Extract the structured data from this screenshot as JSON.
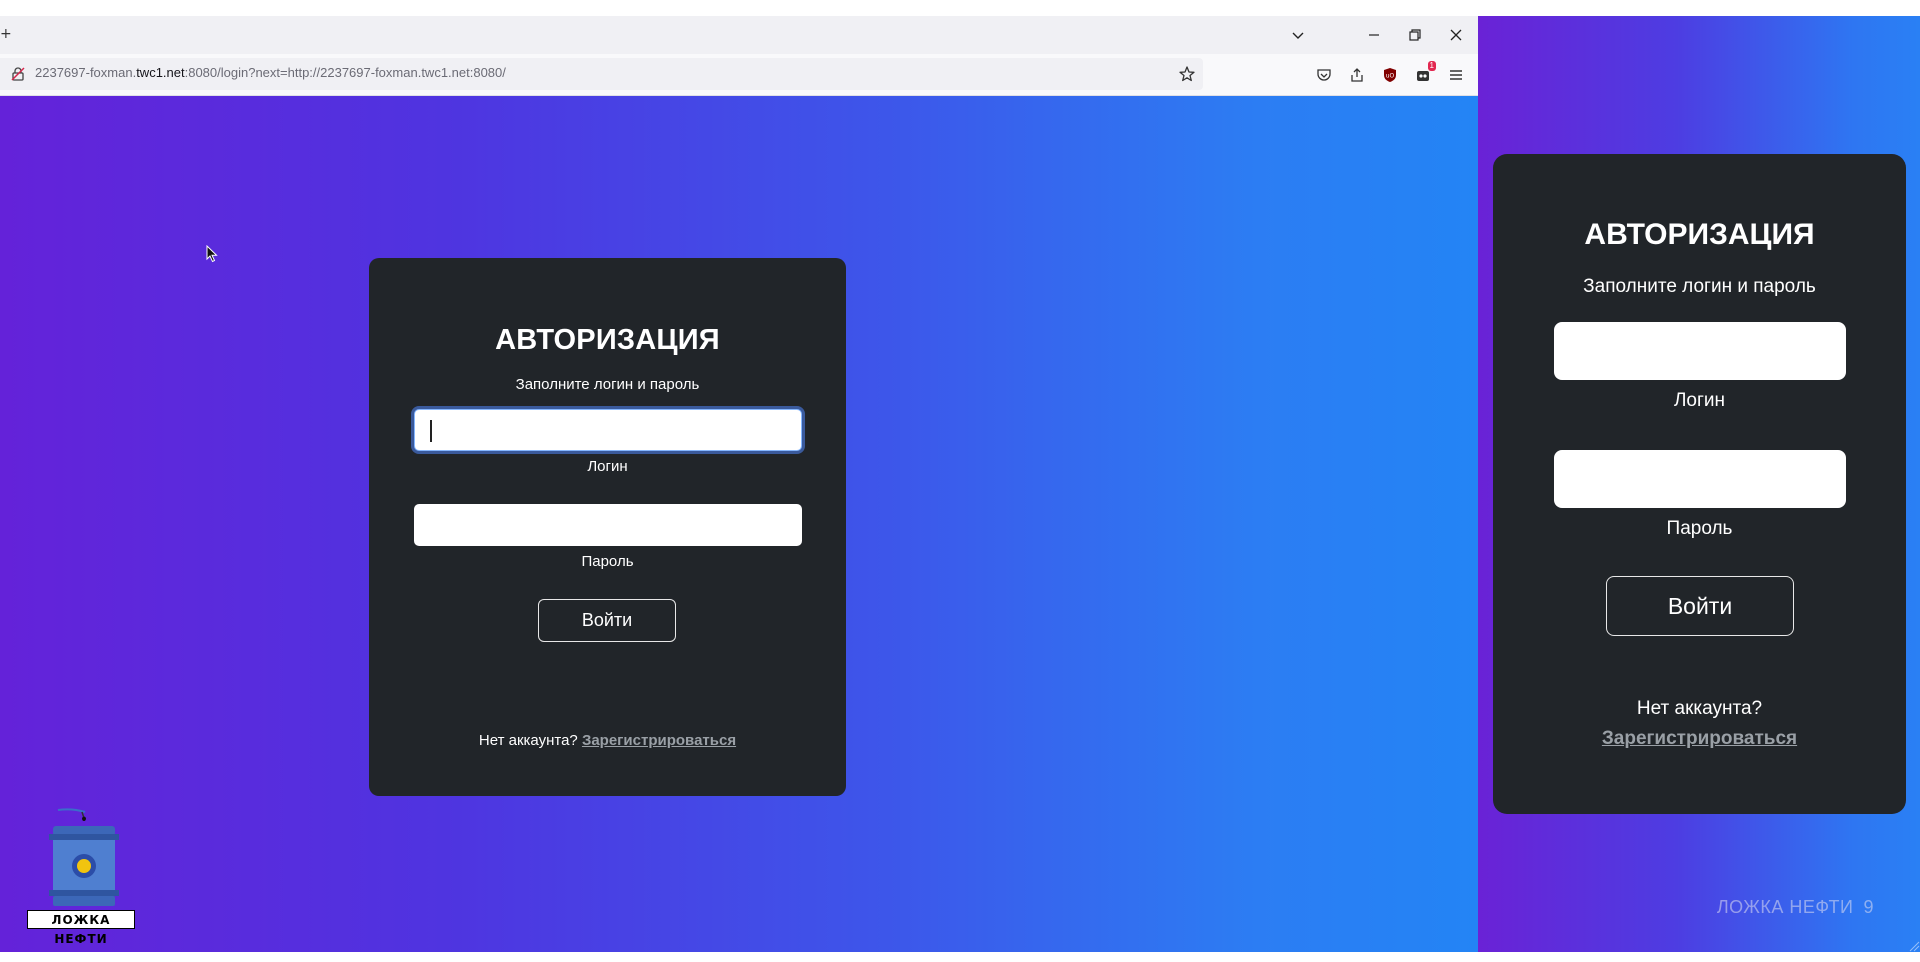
{
  "browser": {
    "url_prefix": "2237697-foxman.",
    "url_host": "twc1.net",
    "url_rest": ":8080/login?next=http://2237697-foxman.twc1.net:8080/",
    "extension_badge": "1"
  },
  "login_card": {
    "title": "АВТОРИЗАЦИЯ",
    "subtitle": "Заполните логин и пароль",
    "login_label": "Логин",
    "password_label": "Пароль",
    "submit_label": "Войти",
    "no_account": "Нет аккаунта?",
    "register_link": "Зарегистрироваться"
  },
  "logo": {
    "text": "ЛОЖКА НЕФТИ"
  },
  "slide": {
    "card": {
      "title": "АВТОРИЗАЦИЯ",
      "subtitle": "Заполните логин и пароль",
      "login_label": "Логин",
      "password_label": "Пароль",
      "submit_label": "Войти",
      "no_account": "Нет аккаунта?",
      "register_link": "Зарегистрироваться"
    },
    "footer_text": "ЛОЖКА НЕФТИ",
    "page_number": "9"
  },
  "colors": {
    "gradient_left": "#6422d9",
    "gradient_right": "#2384f5",
    "card_bg": "#212529",
    "link_color": "#9aa0a6"
  }
}
